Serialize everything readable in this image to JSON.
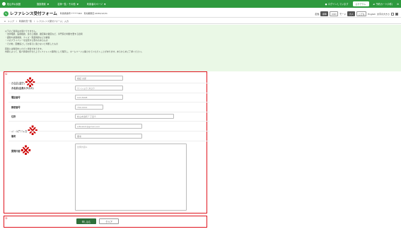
{
  "topbar": {
    "site": "松山市公民館",
    "nav": [
      {
        "label": "施設検索"
      },
      {
        "label": "名簿一覧・その他"
      },
      {
        "label": "利用者のページ"
      }
    ],
    "login_status": "ログインしています",
    "logout": "ログアウト",
    "cart": "予約カート(0件)"
  },
  "header": {
    "title": "レファレンス受付フォーム",
    "meta": "利用者番号:******363　有効期限日:2030/12/31",
    "tools": {
      "color_label": "配色",
      "chip_normal": "標準",
      "chip_cud": "CUD",
      "mode_label": "モード",
      "chip_large": "大人",
      "chip_kids": "こども",
      "english": "English",
      "size_label": "文字の大きさ"
    }
  },
  "breadcrumb": [
    "トップ",
    "利用状況一覧",
    "レファレンス受付フォーム：入力"
  ],
  "notice": {
    "lines_a": [
      "以下のご質問はお受けできません。",
      "・法律相談、医療相談、身の上相談、鑑定等の鑑定など、専門家の判断を要する質問",
      "・課題や試験問題、クイズ・懸賞問題などの解答",
      "・人のプライバシーを侵害する恐れのあるもの",
      "・その他、図書館としてお答えに適さないと判断したもの"
    ],
    "lines_b": [
      "回答には時間をいただく場合があります。",
      "内容によって、個人情報を伏せた上でレファレンス事例として保存し、ホームページ公開させていただくことがあります。あらかじめご了承ください。"
    ]
  },
  "markers": {
    "form": "①",
    "buttons": "②"
  },
  "form": {
    "name": {
      "label": "お名前(漢字)",
      "required": "※",
      "value": "検証 太郎"
    },
    "kana": {
      "label": "お名前(全角カタカナ)",
      "value": "ケンショウ タロウ"
    },
    "phone": {
      "label": "電話番号",
      "value": "043-8008"
    },
    "postal": {
      "label": "郵便番号",
      "value": "790-0012"
    },
    "address": {
      "label": "住所",
      "value": "松山市湊町７丁目５"
    },
    "email": {
      "label": "メールアドレス",
      "required": "※",
      "value": "sdbrebdr@gmail.com"
    },
    "note": {
      "label": "備考",
      "value": "備考"
    },
    "question": {
      "label": "質問内容",
      "required": "※",
      "placeholder": "質問内容※"
    }
  },
  "buttons": {
    "submit": "申し込む",
    "clear": "クリア"
  },
  "colors": {
    "brand_green": "#2e9a3e",
    "notice_bg": "#eaf8e6",
    "highlight_red": "#e0141e",
    "submit_green": "#2f6f3a"
  }
}
